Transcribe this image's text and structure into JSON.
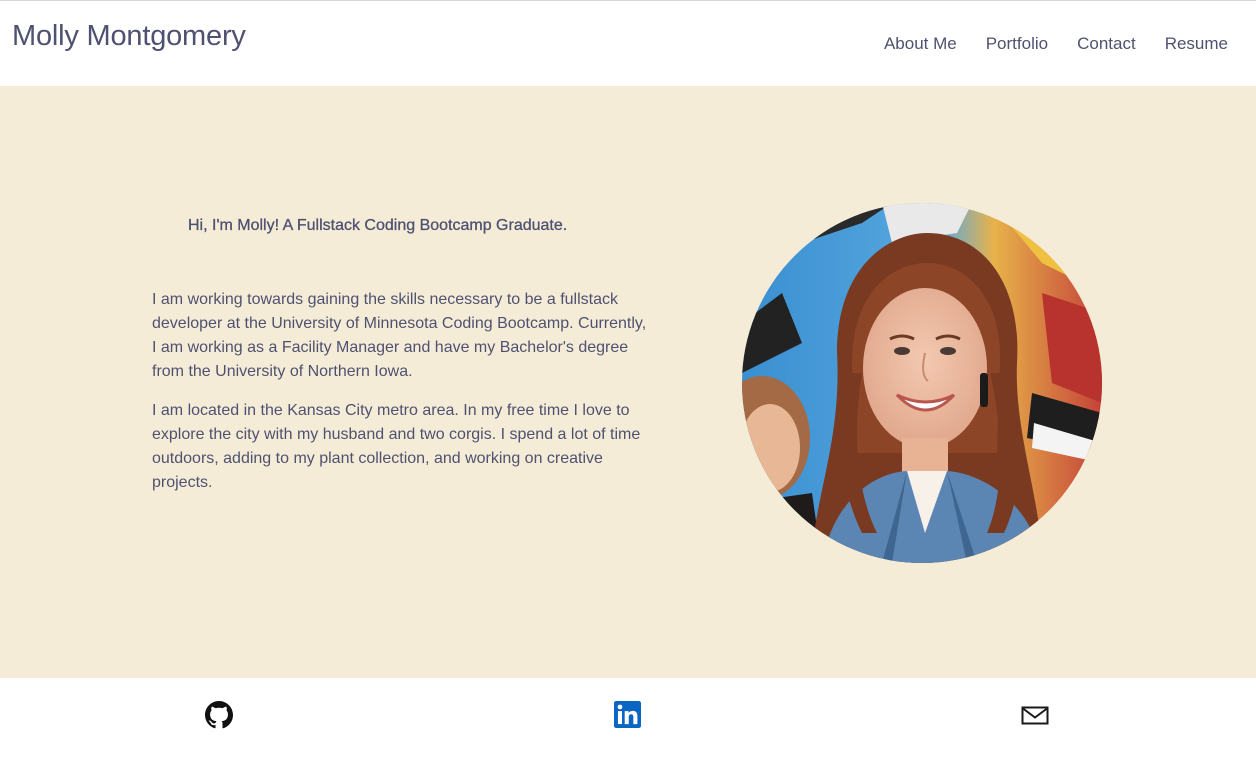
{
  "header": {
    "brand": "Molly Montgomery",
    "nav": [
      {
        "label": "About Me"
      },
      {
        "label": "Portfolio"
      },
      {
        "label": "Contact"
      },
      {
        "label": "Resume"
      }
    ]
  },
  "hero": {
    "heading": "Hi, I'm Molly! A Fullstack Coding Bootcamp Graduate.",
    "paragraphs": [
      "I am working towards gaining the skills necessary to be a fullstack developer at the University of Minnesota Coding Bootcamp. Currently, I am working as a Facility Manager and have my Bachelor's degree from the University of Northern Iowa.",
      "I am located in the Kansas City metro area. In my free time I love to explore the city with my husband and two corgis. I spend a lot of time outdoors, adding to my plant collection, and working on creative projects."
    ],
    "background_color": "#f5ecd8",
    "text_color": "#4f5170"
  },
  "footer": {
    "links": [
      {
        "icon": "github-icon"
      },
      {
        "icon": "linkedin-icon",
        "color": "#0a66c2"
      },
      {
        "icon": "email-icon"
      }
    ]
  }
}
